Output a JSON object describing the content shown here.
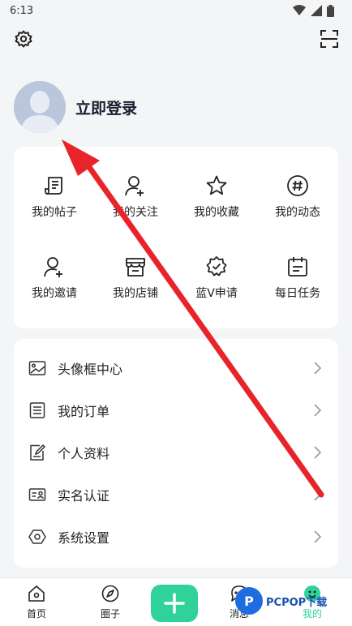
{
  "status_bar": {
    "time": "6:13"
  },
  "profile": {
    "login_label": "立即登录"
  },
  "grid": {
    "items": [
      {
        "label": "我的帖子",
        "icon": "post-icon"
      },
      {
        "label": "我的关注",
        "icon": "follow-icon"
      },
      {
        "label": "我的收藏",
        "icon": "star-icon"
      },
      {
        "label": "我的动态",
        "icon": "hashtag-icon"
      },
      {
        "label": "我的邀请",
        "icon": "invite-icon"
      },
      {
        "label": "我的店铺",
        "icon": "store-icon"
      },
      {
        "label": "蓝V申请",
        "icon": "verified-badge-icon"
      },
      {
        "label": "每日任务",
        "icon": "calendar-icon"
      }
    ]
  },
  "list": {
    "items": [
      {
        "label": "头像框中心",
        "icon": "image-frame-icon"
      },
      {
        "label": "我的订单",
        "icon": "order-icon"
      },
      {
        "label": "个人资料",
        "icon": "edit-profile-icon"
      },
      {
        "label": "实名认证",
        "icon": "id-card-icon"
      },
      {
        "label": "系统设置",
        "icon": "settings-hexagon-icon"
      }
    ]
  },
  "bottom_nav": {
    "items": [
      {
        "label": "首页",
        "icon": "home-icon"
      },
      {
        "label": "圈子",
        "icon": "compass-icon"
      },
      {
        "label": "消息",
        "icon": "message-icon"
      },
      {
        "label": "我的",
        "icon": "me-icon"
      }
    ]
  },
  "watermark": {
    "text": "PCPOP下载"
  },
  "colors": {
    "accent": "#2fd39a",
    "arrow": "#e8232a",
    "background": "#f4f5f7"
  }
}
